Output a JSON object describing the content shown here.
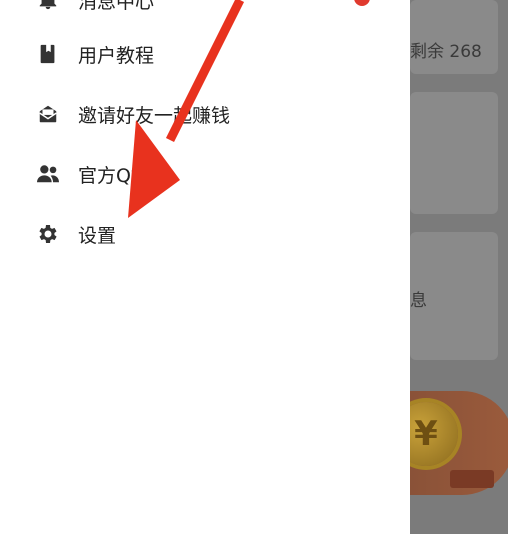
{
  "background": {
    "remaining_text": "剩余 268",
    "info_text": "息",
    "coin_symbol": "¥"
  },
  "drawer": {
    "items": [
      {
        "label": "消息中心",
        "icon": "bell-icon"
      },
      {
        "label": "用户教程",
        "icon": "book-icon"
      },
      {
        "label": "邀请好友一起赚钱",
        "icon": "envelope-icon"
      },
      {
        "label": "官方Q群",
        "icon": "users-icon"
      },
      {
        "label": "设置",
        "icon": "gear-icon"
      }
    ]
  },
  "colors": {
    "arrow": "#e8321e",
    "badge": "#e03a2e",
    "icon": "#333333",
    "overlay": "#7b7b7b"
  }
}
